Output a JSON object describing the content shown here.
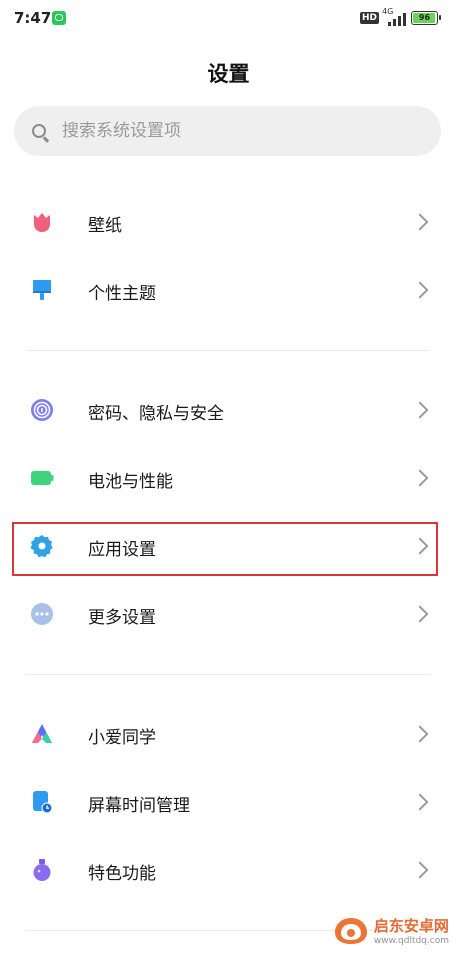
{
  "status_bar": {
    "time": "7:47",
    "hd": "HD",
    "network": "4G",
    "battery": "96"
  },
  "page": {
    "title": "设置"
  },
  "search": {
    "placeholder": "搜索系统设置项"
  },
  "groups": [
    {
      "items": [
        {
          "label": "壁纸",
          "icon": "tulip-icon"
        },
        {
          "label": "个性主题",
          "icon": "brush-icon"
        }
      ]
    },
    {
      "items": [
        {
          "label": "密码、隐私与安全",
          "icon": "fingerprint-icon"
        },
        {
          "label": "电池与性能",
          "icon": "battery-icon"
        },
        {
          "label": "应用设置",
          "icon": "gear-icon",
          "highlighted": true
        },
        {
          "label": "更多设置",
          "icon": "more-dots-icon"
        }
      ]
    },
    {
      "items": [
        {
          "label": "小爱同学",
          "icon": "xiaoai-icon"
        },
        {
          "label": "屏幕时间管理",
          "icon": "screen-time-icon"
        },
        {
          "label": "特色功能",
          "icon": "flask-icon"
        }
      ]
    }
  ],
  "watermark": {
    "title": "启东安卓网",
    "url": "www.qdltdq.com"
  },
  "colors": {
    "highlight_border": "#d9363e",
    "wallpaper_icon": "#f0607a",
    "theme_icon": "#2f9bf0",
    "privacy_icon": "#7e7ef0",
    "battery_icon": "#3fd37d",
    "gear_icon": "#2fa3e6",
    "more_icon": "#a9c0e8"
  }
}
